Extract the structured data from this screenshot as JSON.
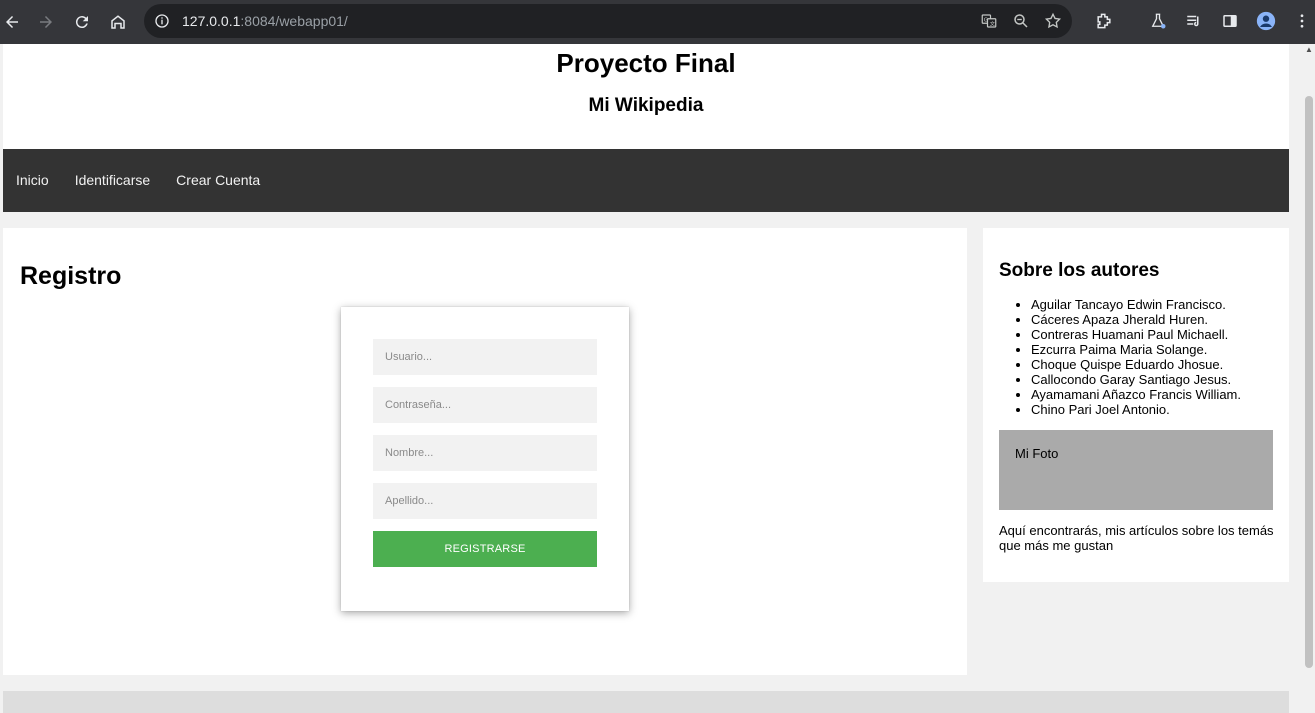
{
  "browser": {
    "url_host": "127.0.0.1",
    "url_rest": ":8084/webapp01/"
  },
  "header": {
    "title": "Proyecto Final",
    "subtitle": "Mi Wikipedia"
  },
  "topnav": {
    "items": [
      "Inicio",
      "Identificarse",
      "Crear Cuenta"
    ]
  },
  "main": {
    "heading": "Registro",
    "form": {
      "usuario_placeholder": "Usuario...",
      "password_placeholder": "Contraseña...",
      "nombre_placeholder": "Nombre...",
      "apellido_placeholder": "Apellido...",
      "submit_label": "REGISTRARSE",
      "submit_color": "#4caf50"
    }
  },
  "sidebar": {
    "heading": "Sobre los autores",
    "authors": [
      "Aguilar Tancayo Edwin Francisco.",
      "Cáceres Apaza Jherald Huren.",
      "Contreras Huamani Paul Michaell.",
      "Ezcurra Paima Maria Solange.",
      "Choque Quispe Eduardo Jhosue.",
      "Callocondo Garay Santiago Jesus.",
      "Ayamamani Añazco Francis William.",
      "Chino Pari Joel Antonio."
    ],
    "photo_label": "Mi Foto",
    "blurb": "Aquí encontrarás, mis artículos sobre los temás que más me gustan"
  },
  "colors": {
    "nav_bg": "#333333",
    "page_bg": "#f1f1f1",
    "photo_bg": "#aaaaaa"
  }
}
